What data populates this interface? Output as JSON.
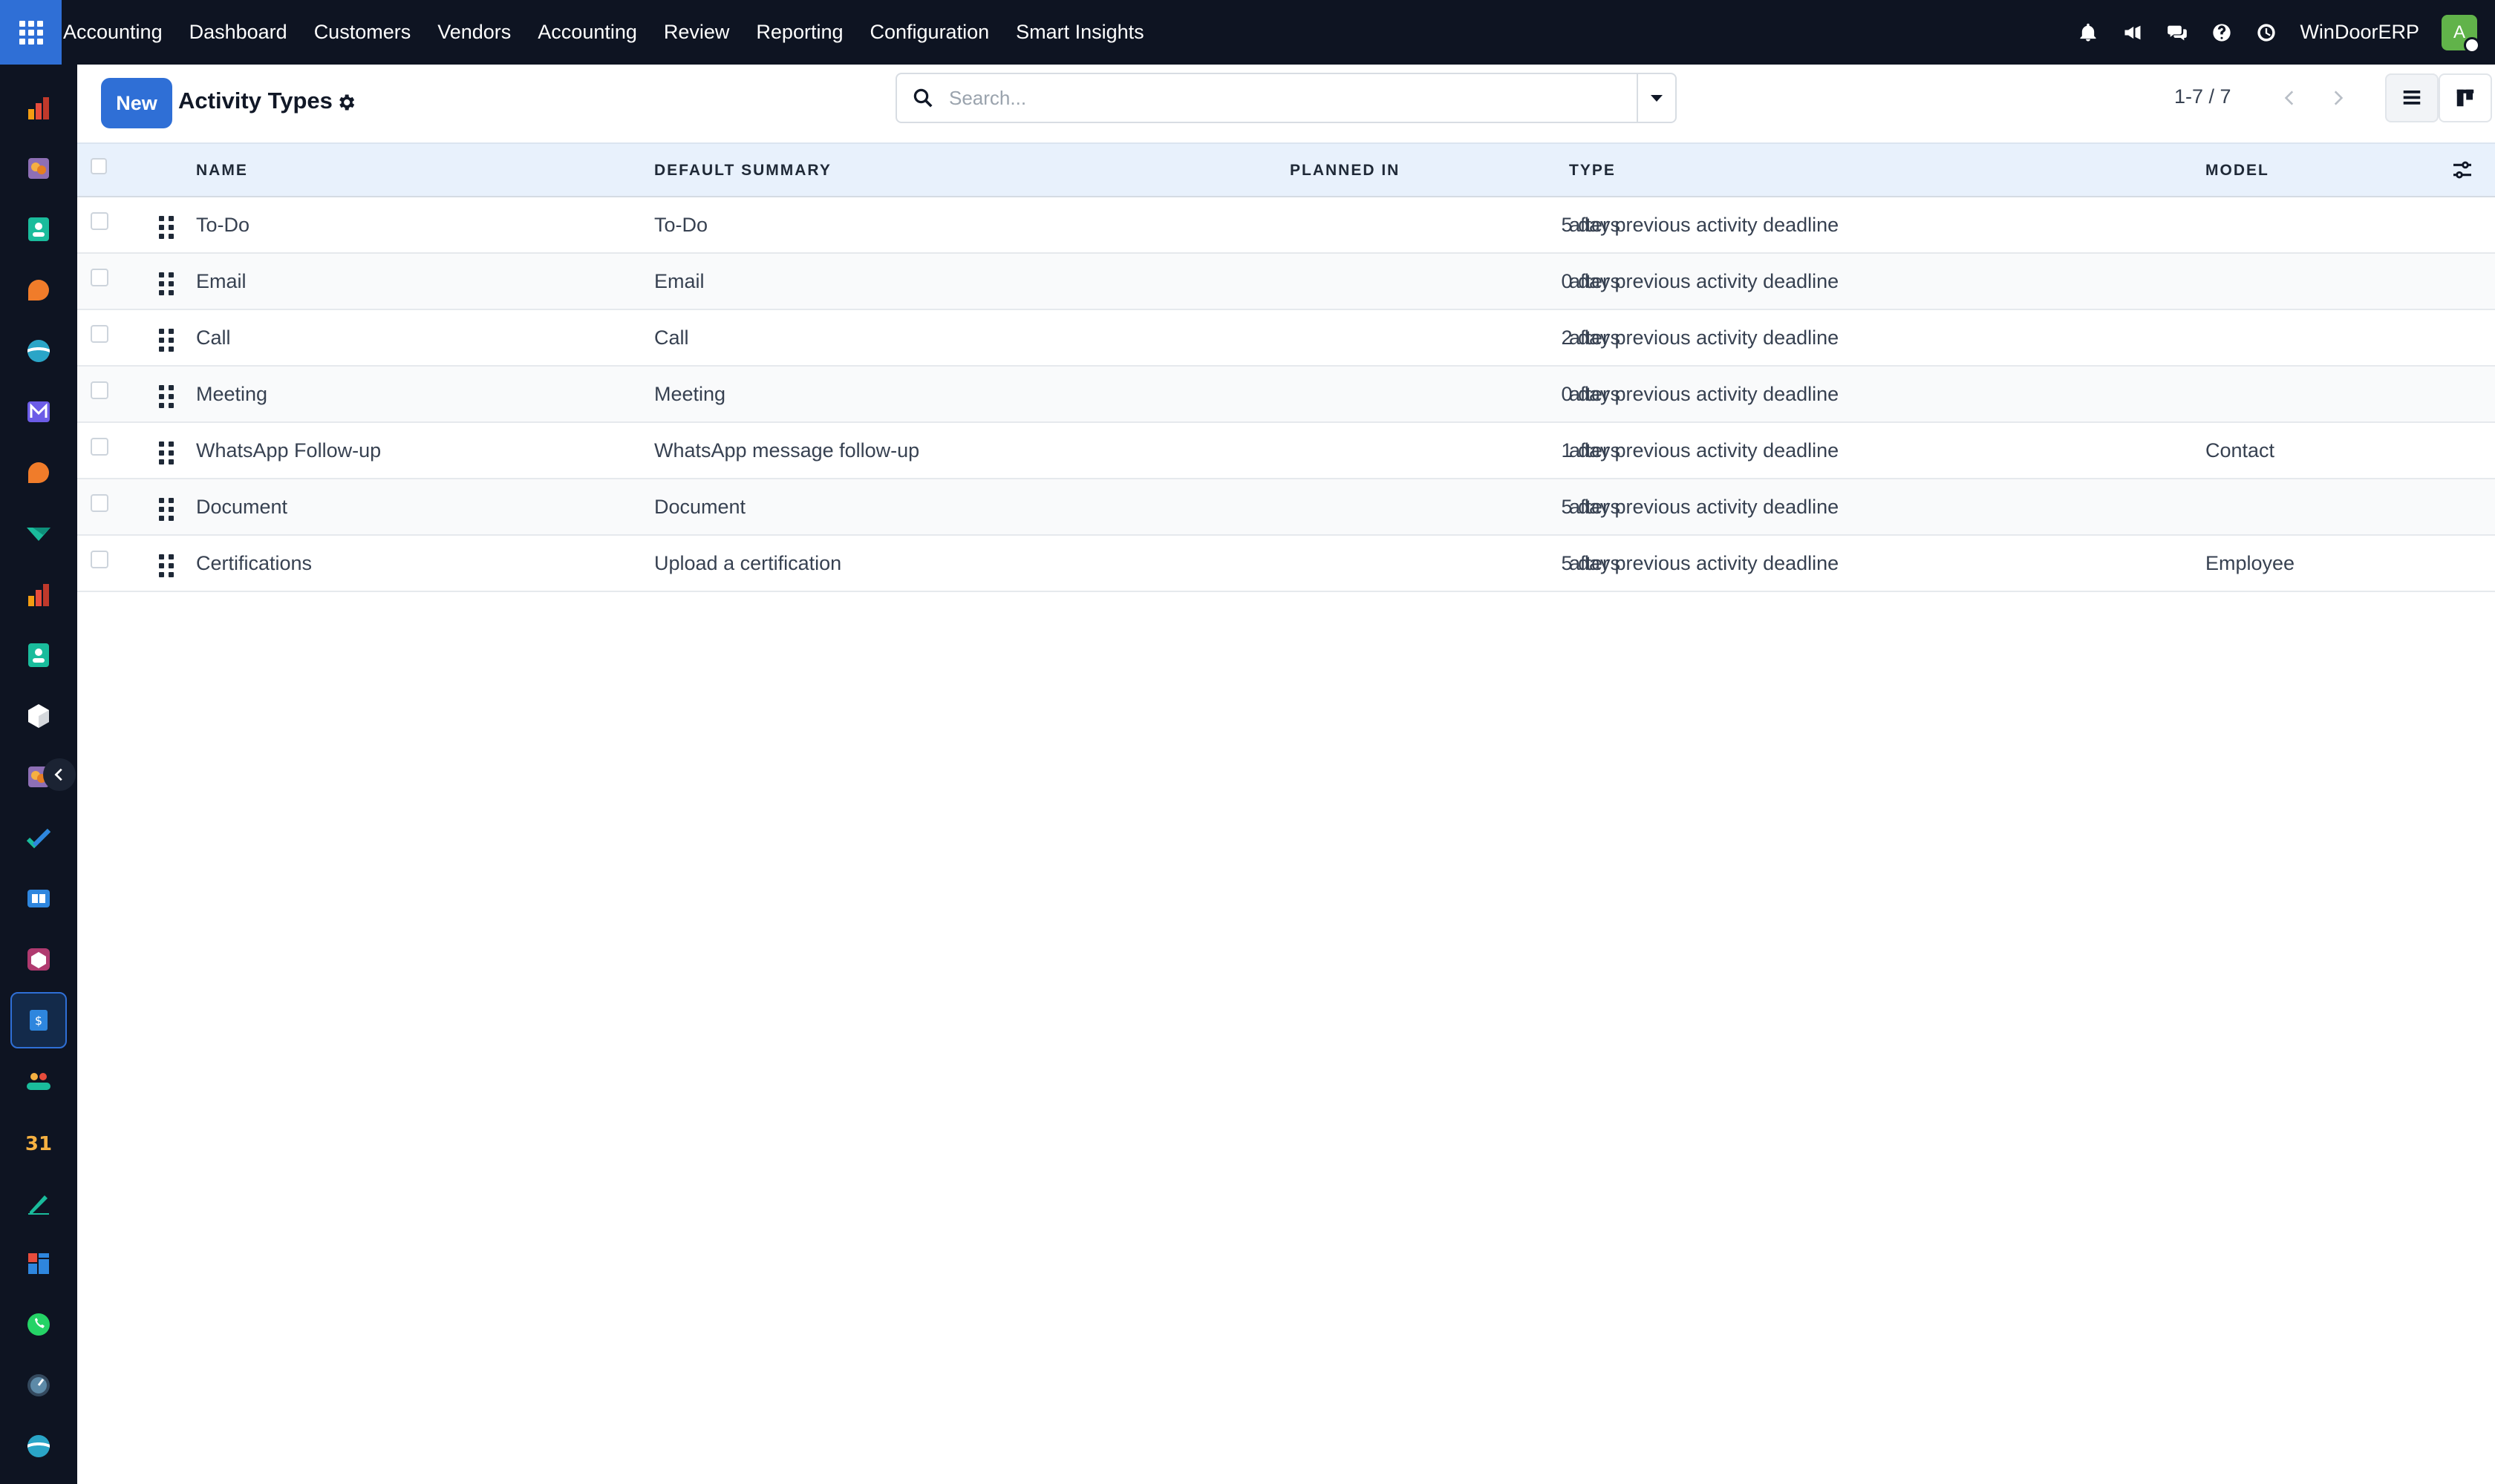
{
  "navbar": {
    "brand": "Accounting",
    "menu": [
      "Dashboard",
      "Customers",
      "Vendors",
      "Accounting",
      "Review",
      "Reporting",
      "Configuration",
      "Smart Insights"
    ],
    "company": "WinDoorERP",
    "avatar_letter": "A",
    "icons": [
      "bell-icon",
      "megaphone-icon",
      "chat-icon",
      "help-icon",
      "clock-icon"
    ]
  },
  "control_panel": {
    "new_label": "New",
    "title": "Activity Types",
    "search_placeholder": "Search...",
    "pager": "1-7 / 7"
  },
  "table": {
    "columns": [
      "NAME",
      "DEFAULT SUMMARY",
      "PLANNED IN",
      "TYPE",
      "MODEL"
    ],
    "rows": [
      {
        "name": "To-Do",
        "summary": "To-Do",
        "planned": "5 days",
        "type": "after previous activity deadline",
        "model": ""
      },
      {
        "name": "Email",
        "summary": "Email",
        "planned": "0 days",
        "type": "after previous activity deadline",
        "model": ""
      },
      {
        "name": "Call",
        "summary": "Call",
        "planned": "2 days",
        "type": "after previous activity deadline",
        "model": ""
      },
      {
        "name": "Meeting",
        "summary": "Meeting",
        "planned": "0 days",
        "type": "after previous activity deadline",
        "model": ""
      },
      {
        "name": "WhatsApp Follow-up",
        "summary": "WhatsApp message follow-up",
        "planned": "1 days",
        "type": "after previous activity deadline",
        "model": "Contact"
      },
      {
        "name": "Document",
        "summary": "Document",
        "planned": "5 days",
        "type": "after previous activity deadline",
        "model": ""
      },
      {
        "name": "Certifications",
        "summary": "Upload a certification",
        "planned": "5 days",
        "type": "after previous activity deadline",
        "model": "Employee"
      }
    ]
  },
  "rail_labels": {
    "calendar_day": "31"
  },
  "colors": {
    "topbar": "#0e1422",
    "accent": "#2f6fd6",
    "header_row": "#e8f1fc"
  }
}
